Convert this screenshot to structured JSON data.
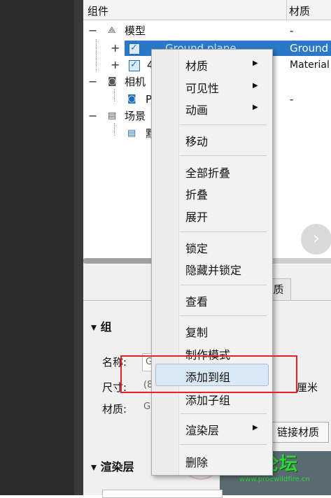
{
  "tree": {
    "headers": {
      "component": "组件",
      "material": "材质"
    },
    "rows": [
      {
        "expander": "−",
        "icon": "model-icon",
        "label": "模型",
        "material": "-"
      },
      {
        "expander": "+",
        "label": "Ground plane",
        "material": "Ground"
      },
      {
        "expander": "+",
        "label": "4",
        "material": "Material"
      },
      {
        "expander": "−",
        "icon": "camera-icon",
        "label": "相机",
        "material": ""
      },
      {
        "label": "P",
        "material": "-"
      },
      {
        "expander": "−",
        "icon": "scene-icon",
        "label": "场景",
        "material": ""
      },
      {
        "label": "默"
      }
    ]
  },
  "tab_label": "质",
  "properties": {
    "section_group": "组",
    "name_label": "名称:",
    "name_value": "G",
    "size_label": "尺寸:",
    "size_value": "(8",
    "size_unit": "厘米",
    "material_label": "材质:",
    "material_value": "G",
    "link_material_button": "链接材质",
    "section_render_layer": "渲染层"
  },
  "context_menu": {
    "material": "材质",
    "visibility": "可见性",
    "animation": "动画",
    "move": "移动",
    "collapse_all": "全部折叠",
    "collapse": "折叠",
    "expand": "展开",
    "lock": "锁定",
    "hide_and_lock": "隐藏并锁定",
    "look_at": "查看",
    "copy": "复制",
    "make_pattern": "制作模式",
    "add_to_group": "添加到组",
    "add_subgroup": "添加子组",
    "render_layer": "渲染层",
    "delete": "删除"
  },
  "watermark": {
    "text": "野火论坛",
    "url": "www.proewildfire.cn"
  },
  "colors": {
    "selection": "#2b78c8",
    "highlight_box": "#e5222a",
    "menu_hover": "#dbe8f6"
  }
}
